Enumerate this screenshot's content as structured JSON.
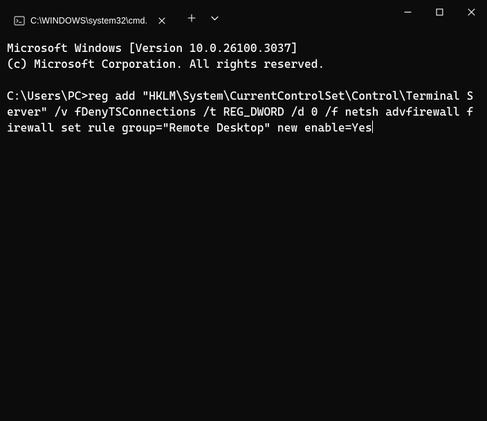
{
  "tab": {
    "title": "C:\\WINDOWS\\system32\\cmd."
  },
  "terminal": {
    "line1": "Microsoft Windows [Version 10.0.26100.3037]",
    "line2": "(c) Microsoft Corporation. All rights reserved.",
    "blank": "",
    "prompt": "C:\\Users\\PC>",
    "command": "reg add \"HKLM\\System\\CurrentControlSet\\Control\\Terminal Server\" /v fDenyTSConnections /t REG_DWORD /d 0 /f netsh advfirewall firewall set rule group=\"Remote Desktop\" new enable=Yes"
  }
}
